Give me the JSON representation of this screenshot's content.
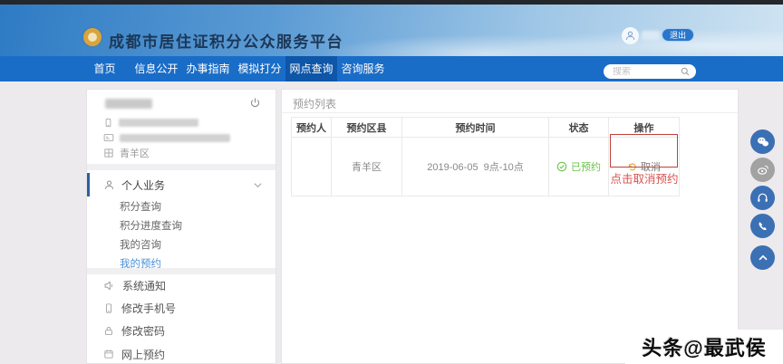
{
  "header": {
    "title": "成都市居住证积分公众服务平台",
    "logout_label": "退出"
  },
  "nav": {
    "items": [
      {
        "label": "首页",
        "active": false
      },
      {
        "label": "信息公开",
        "active": false
      },
      {
        "label": "办事指南",
        "active": false
      },
      {
        "label": "模拟打分",
        "active": false
      },
      {
        "label": "网点查询",
        "active": true
      },
      {
        "label": "咨询服务",
        "active": false
      }
    ],
    "search": {
      "placeholder": "搜索"
    }
  },
  "sidebar": {
    "user": {
      "district": "青羊区"
    },
    "group_label": "个人业务",
    "menu_items": [
      "积分查询",
      "积分进度查询",
      "我的咨询",
      "我的预约"
    ],
    "active_menu_item": "我的预约",
    "tools": [
      "系统通知",
      "修改手机号",
      "修改密码",
      "网上预约"
    ]
  },
  "main": {
    "panel_title": "预约列表",
    "table": {
      "headers": [
        "预约人",
        "预约区县",
        "预约时间",
        "状态",
        "操作"
      ],
      "row": {
        "district": "青羊区",
        "time": "2019-06-05  9点-10点",
        "status": "已预约",
        "action": "取消"
      }
    },
    "annotation": "点击取消预约"
  },
  "watermark": {
    "text": "头条@最武侯"
  },
  "colors": {
    "nav_blue": "#1a6dc7",
    "nav_active_blue": "#0e56a8",
    "status_green": "#6cc24a",
    "annotation_red": "#d9534f",
    "cancel_icon_yellow": "#dfa528",
    "active_link_blue": "#4a90d9",
    "float_button_blue": "#3b70b4"
  }
}
